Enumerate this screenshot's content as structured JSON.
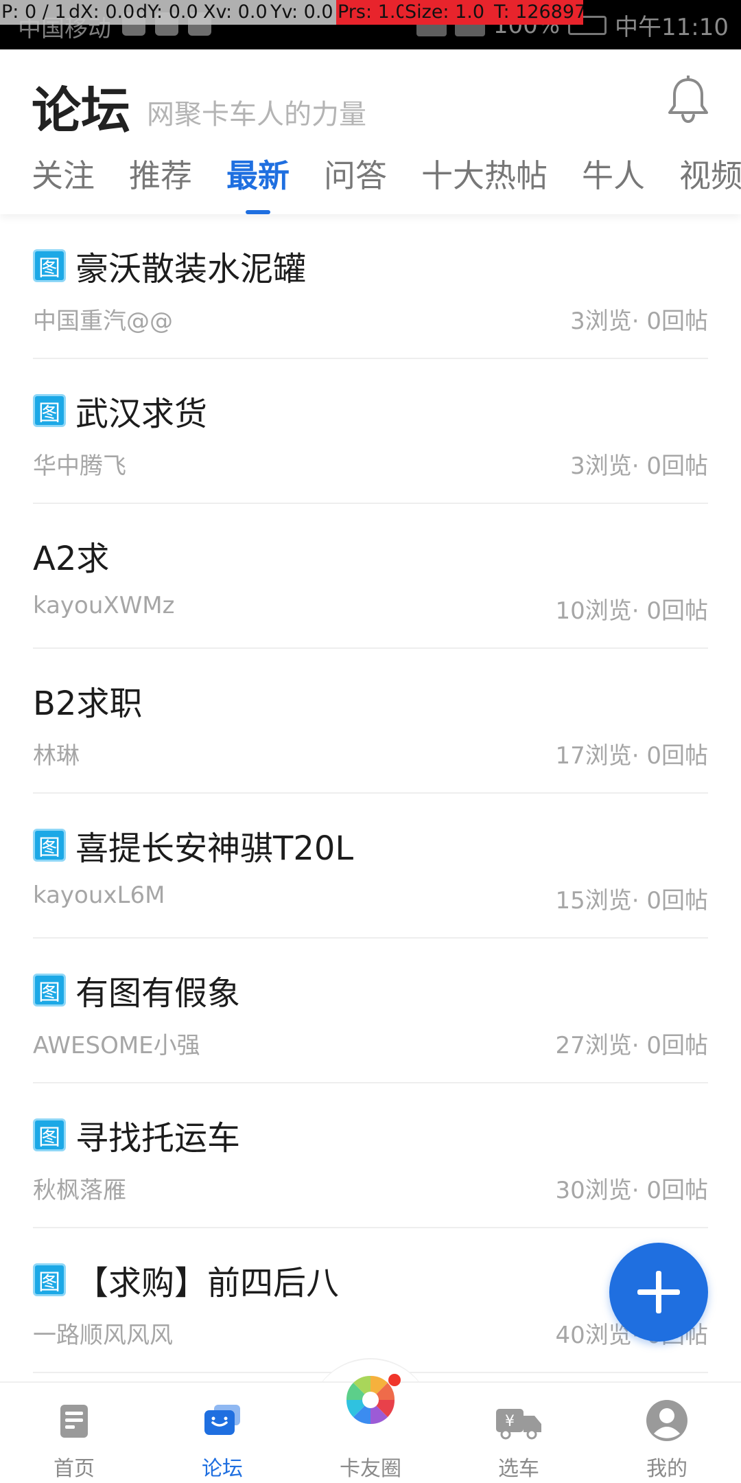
{
  "statusbar": {
    "carrier": "中国移动",
    "battery": "100%",
    "time": "中午11:10"
  },
  "debug": {
    "p": "P: 0 / 1",
    "dx": "dX: 0.0",
    "dy": "dY: 0.0",
    "xv": "Xv: 0.0",
    "yv": "Yv: 0.0",
    "prs": "Prs: 1.0",
    "size": "Size: 1.0",
    "t": "T: 126897"
  },
  "header": {
    "title": "论坛",
    "subtitle": "网聚卡车人的力量",
    "tabs": [
      "关注",
      "推荐",
      "最新",
      "问答",
      "十大热帖",
      "牛人",
      "视频"
    ],
    "active_tab": "最新"
  },
  "tag_label": "图",
  "posts": [
    {
      "title": "豪沃散装水泥罐",
      "author": "中国重汽@@",
      "stats": "3浏览· 0回帖",
      "has_image": true
    },
    {
      "title": "武汉求货",
      "author": "华中腾飞",
      "stats": "3浏览· 0回帖",
      "has_image": true
    },
    {
      "title": "A2求",
      "author": "kayouXWMz",
      "stats": "10浏览· 0回帖",
      "has_image": false
    },
    {
      "title": "B2求职",
      "author": "林琳",
      "stats": "17浏览· 0回帖",
      "has_image": false
    },
    {
      "title": "喜提长安神骐T20L",
      "author": "kayouxL6M",
      "stats": "15浏览· 0回帖",
      "has_image": true
    },
    {
      "title": "有图有假象",
      "author": "AWESOME小强",
      "stats": "27浏览· 0回帖",
      "has_image": true
    },
    {
      "title": "寻找托运车",
      "author": "秋枫落雁",
      "stats": "30浏览· 0回帖",
      "has_image": true
    },
    {
      "title": "【求购】前四后八",
      "author": "一路顺风风风",
      "stats": "40浏览· 0回帖",
      "has_image": true
    }
  ],
  "bottom_nav": [
    {
      "label": "首页",
      "icon": "home-icon"
    },
    {
      "label": "论坛",
      "icon": "forum-icon"
    },
    {
      "label": "卡友圈",
      "icon": "pinwheel-icon"
    },
    {
      "label": "选车",
      "icon": "truck-icon"
    },
    {
      "label": "我的",
      "icon": "profile-icon"
    }
  ],
  "colors": {
    "accent": "#1f6fe0",
    "tag": "#1ca8e6",
    "muted": "#a6a6a6"
  }
}
